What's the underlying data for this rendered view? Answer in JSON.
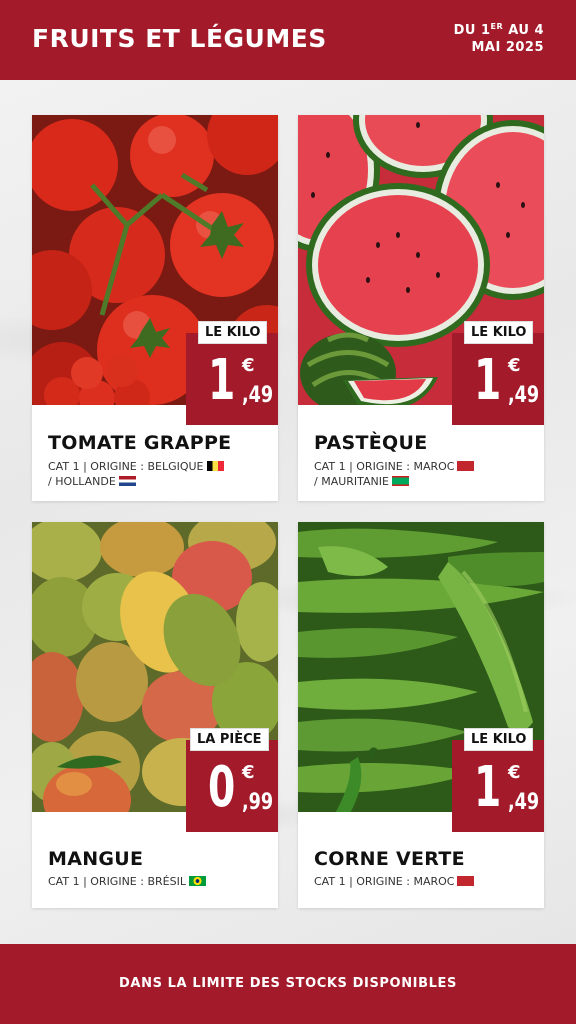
{
  "header": {
    "title": "FRUITS ET LÉGUMES",
    "date_prefix": "DU 1",
    "date_sup": "ER",
    "date_suffix": " AU 4",
    "date_line2": "MAI 2025"
  },
  "products": [
    {
      "name": "TOMATE GRAPPE",
      "origin_line1": "CAT 1 | ORIGINE : BELGIQUE",
      "origin_line2": "/ HOLLANDE",
      "flag1": "belgium-flag-icon",
      "flag2": "netherlands-flag-icon",
      "unit": "LE KILO",
      "price_int": "1",
      "price_currency": "€",
      "price_dec": ",49"
    },
    {
      "name": "PASTÈQUE",
      "origin_line1": "CAT 1 | ORIGINE : MAROC",
      "origin_line2": "/ MAURITANIE",
      "flag1": "morocco-flag-icon",
      "flag2": "mauritania-flag-icon",
      "unit": "LE KILO",
      "price_int": "1",
      "price_currency": "€",
      "price_dec": ",49"
    },
    {
      "name": "MANGUE",
      "origin_line1": "CAT 1 | ORIGINE : BRÉSIL",
      "flag1": "brazil-flag-icon",
      "unit": "LA PIÈCE",
      "price_int": "0",
      "price_currency": "€",
      "price_dec": ",99"
    },
    {
      "name": "CORNE VERTE",
      "origin_line1": "CAT 1 | ORIGINE : MAROC",
      "flag1": "morocco-flag-icon",
      "unit": "LE KILO",
      "price_int": "1",
      "price_currency": "€",
      "price_dec": ",49"
    }
  ],
  "footer": {
    "text": "DANS LA LIMITE DES STOCKS DISPONIBLES"
  },
  "colors": {
    "brand_red": "#a31b2a",
    "background": "#ececec"
  }
}
